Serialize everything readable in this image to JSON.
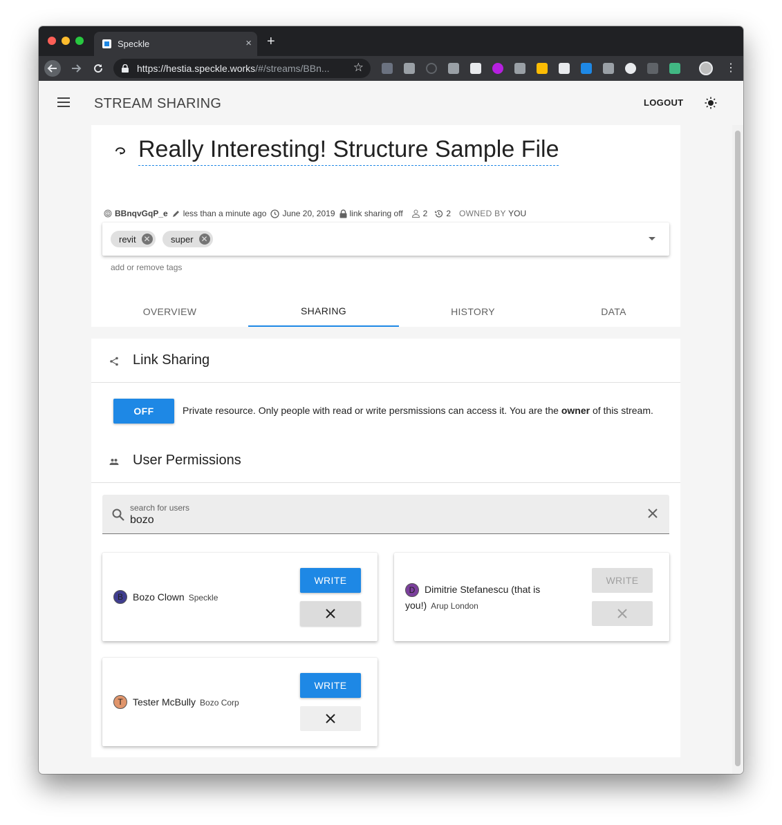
{
  "browser": {
    "tab_title": "Speckle",
    "tab_close": "×",
    "new_tab": "+",
    "url_host": "https://hestia.speckle.works",
    "url_rest": "/#/streams/BBn..."
  },
  "appbar": {
    "title": "STREAM SHARING",
    "logout_label": "LOGOUT"
  },
  "stream": {
    "title": "Really Interesting! Structure Sample File",
    "id": "BBnqvGqP_e",
    "edited": "less than a minute ago",
    "date": "June 20, 2019",
    "link_sharing": "link sharing off",
    "users_count": "2",
    "history_count": "2",
    "owned_by_label": "OWNED BY",
    "owner": "YOU",
    "tags": [
      "revit",
      "super"
    ],
    "tags_hint": "add or remove tags"
  },
  "tabs": [
    "OVERVIEW",
    "SHARING",
    "HISTORY",
    "DATA"
  ],
  "link_sharing": {
    "title": "Link Sharing",
    "toggle_label": "OFF",
    "text_before": "Private resource. Only people with read or write persmissions can access it. You are the ",
    "text_bold": "owner",
    "text_after": " of this stream."
  },
  "permissions": {
    "title": "User Permissions",
    "search_label": "search for users",
    "search_value": "bozo",
    "users": [
      {
        "initial": "B",
        "name": "Bozo Clown",
        "org": "Speckle",
        "button": "WRITE",
        "avatar_color": "#3f3d8f"
      },
      {
        "initial": "D",
        "name": "Dimitrie Stefanescu (that is",
        "name2": "you!)",
        "org": "Arup London",
        "button": "WRITE",
        "avatar_color": "#7b3f9c"
      },
      {
        "initial": "T",
        "name": "Tester McBully",
        "org": "Bozo Corp",
        "button": "WRITE",
        "avatar_color": "#e0956b"
      }
    ]
  },
  "colors": {
    "accent": "#1e88e5"
  }
}
